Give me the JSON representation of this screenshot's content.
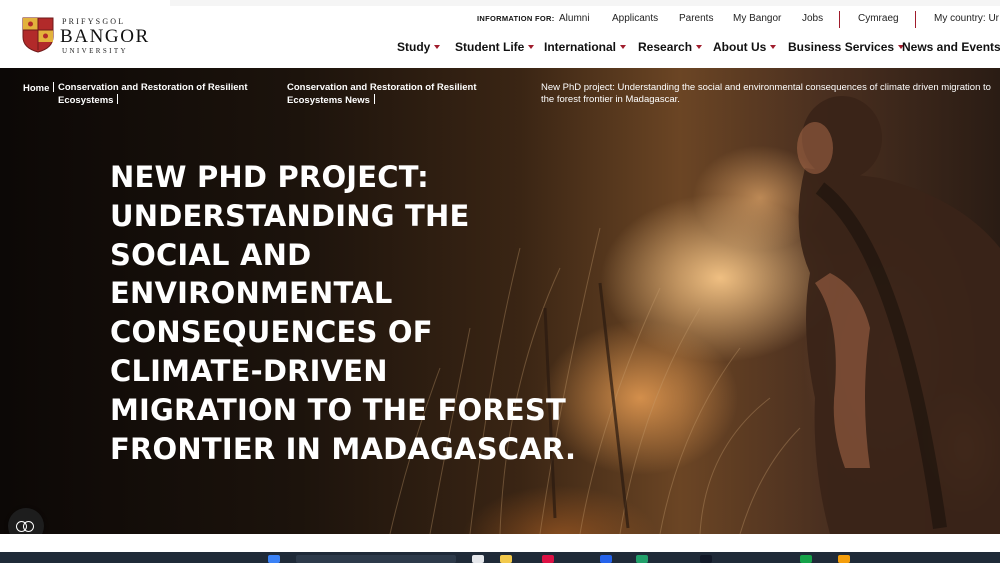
{
  "logo": {
    "prefix": "PRIFYSGOL",
    "name": "BANGOR",
    "suffix": "UNIVERSITY"
  },
  "info_bar": {
    "label": "INFORMATION FOR:",
    "links": [
      "Alumni",
      "Applicants",
      "Parents",
      "My Bangor",
      "Jobs"
    ],
    "language": "Cymraeg",
    "country": "My country: Ur"
  },
  "main_nav": [
    "Study",
    "Student Life",
    "International",
    "Research",
    "About Us",
    "Business Services",
    "News and Events"
  ],
  "breadcrumbs": [
    {
      "label": "Home"
    },
    {
      "label": "Conservation and Restoration of Resilient Ecosystems"
    },
    {
      "label": "Conservation and Restoration of Resilient Ecosystems News"
    },
    {
      "label": "New PhD project: Understanding the social and environmental consequences of climate driven migration to the forest frontier in Madagascar."
    }
  ],
  "hero": {
    "headline": "NEW PHD PROJECT: UNDERSTANDING THE SOCIAL AND ENVIRONMENTAL CONSEQUENCES OF CLIMATE-DRIVEN MIGRATION TO THE FOREST FRONTIER IN MADAGASCAR."
  },
  "accessibility_button": {
    "icon": "accessibility-icon"
  },
  "colors": {
    "accent": "#a01c2c",
    "hero_text": "#ffffff",
    "taskbar": "#1f2a38"
  }
}
